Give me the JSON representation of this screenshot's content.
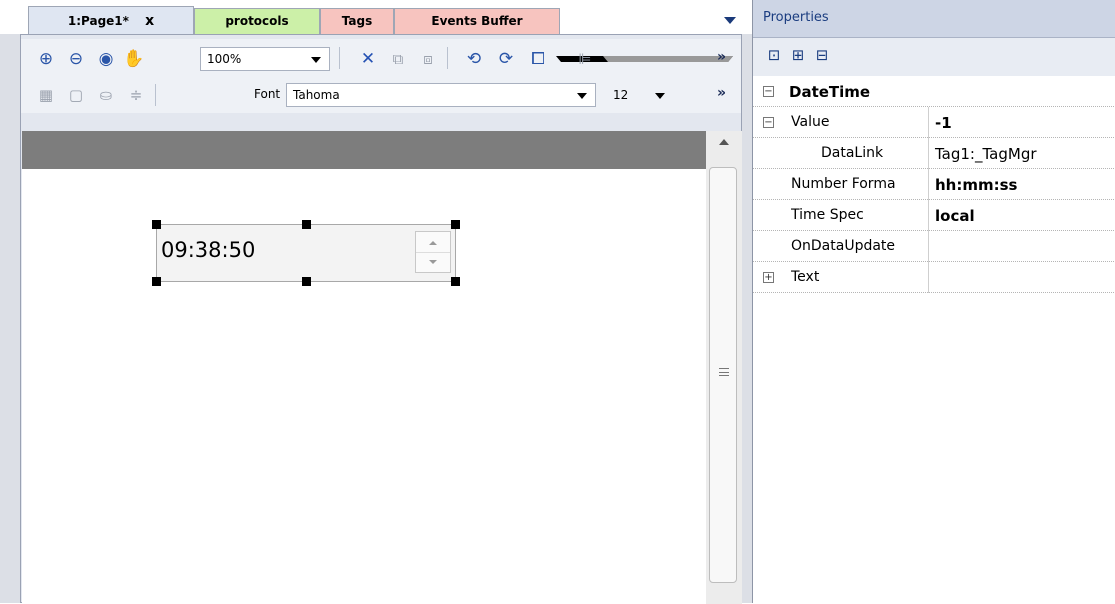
{
  "tabs": [
    {
      "label": "1:Page1*",
      "close": "x"
    },
    {
      "label": "protocols"
    },
    {
      "label": "Tags"
    },
    {
      "label": "Events Buffer"
    }
  ],
  "toolbar1": {
    "zoom_value": "100%",
    "icons": [
      "zoom-in-icon",
      "zoom-out-icon",
      "zoom-fit-icon",
      "pan-hand-icon",
      "delete-icon",
      "group-icon",
      "ungroup-icon",
      "rotate-left-icon",
      "rotate-right-icon",
      "arrange-icon",
      "align-icon"
    ],
    "more": "»"
  },
  "toolbar2": {
    "font_label": "Font",
    "font_value": "Tahoma",
    "size_value": "12",
    "more": "»"
  },
  "widget": {
    "time_value": "09:38:50"
  },
  "properties": {
    "title": "Properties",
    "rows": [
      {
        "name": "DateTime",
        "value": "",
        "expander": "−",
        "bold_name": true
      },
      {
        "name": "Value",
        "value": "-1",
        "expander": "−",
        "bold_value": true
      },
      {
        "name": "DataLink",
        "value": "Tag1:_TagMgr",
        "indent": true
      },
      {
        "name": "Number Forma",
        "value": "hh:mm:ss",
        "bold_value": true
      },
      {
        "name": "Time Spec",
        "value": "local",
        "bold_value": true
      },
      {
        "name": "OnDataUpdate",
        "value": ""
      },
      {
        "name": "Text",
        "value": "",
        "expander": "+"
      }
    ]
  }
}
